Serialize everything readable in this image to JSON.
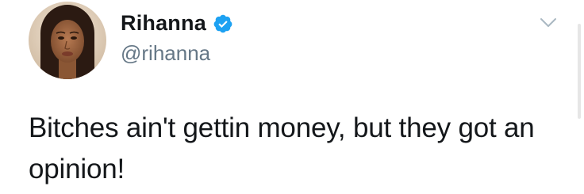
{
  "tweet": {
    "author": {
      "display_name": "Rihanna",
      "handle": "@rihanna",
      "verified": true
    },
    "text": "Bitches ain't gettin money, but they got an opinion!"
  },
  "icons": {
    "verified": "verified-badge-icon",
    "menu": "chevron-down-icon"
  },
  "colors": {
    "verified_blue": "#1da1f2",
    "text_primary": "#14171a",
    "text_secondary": "#657786",
    "caret": "#aab8c2"
  }
}
